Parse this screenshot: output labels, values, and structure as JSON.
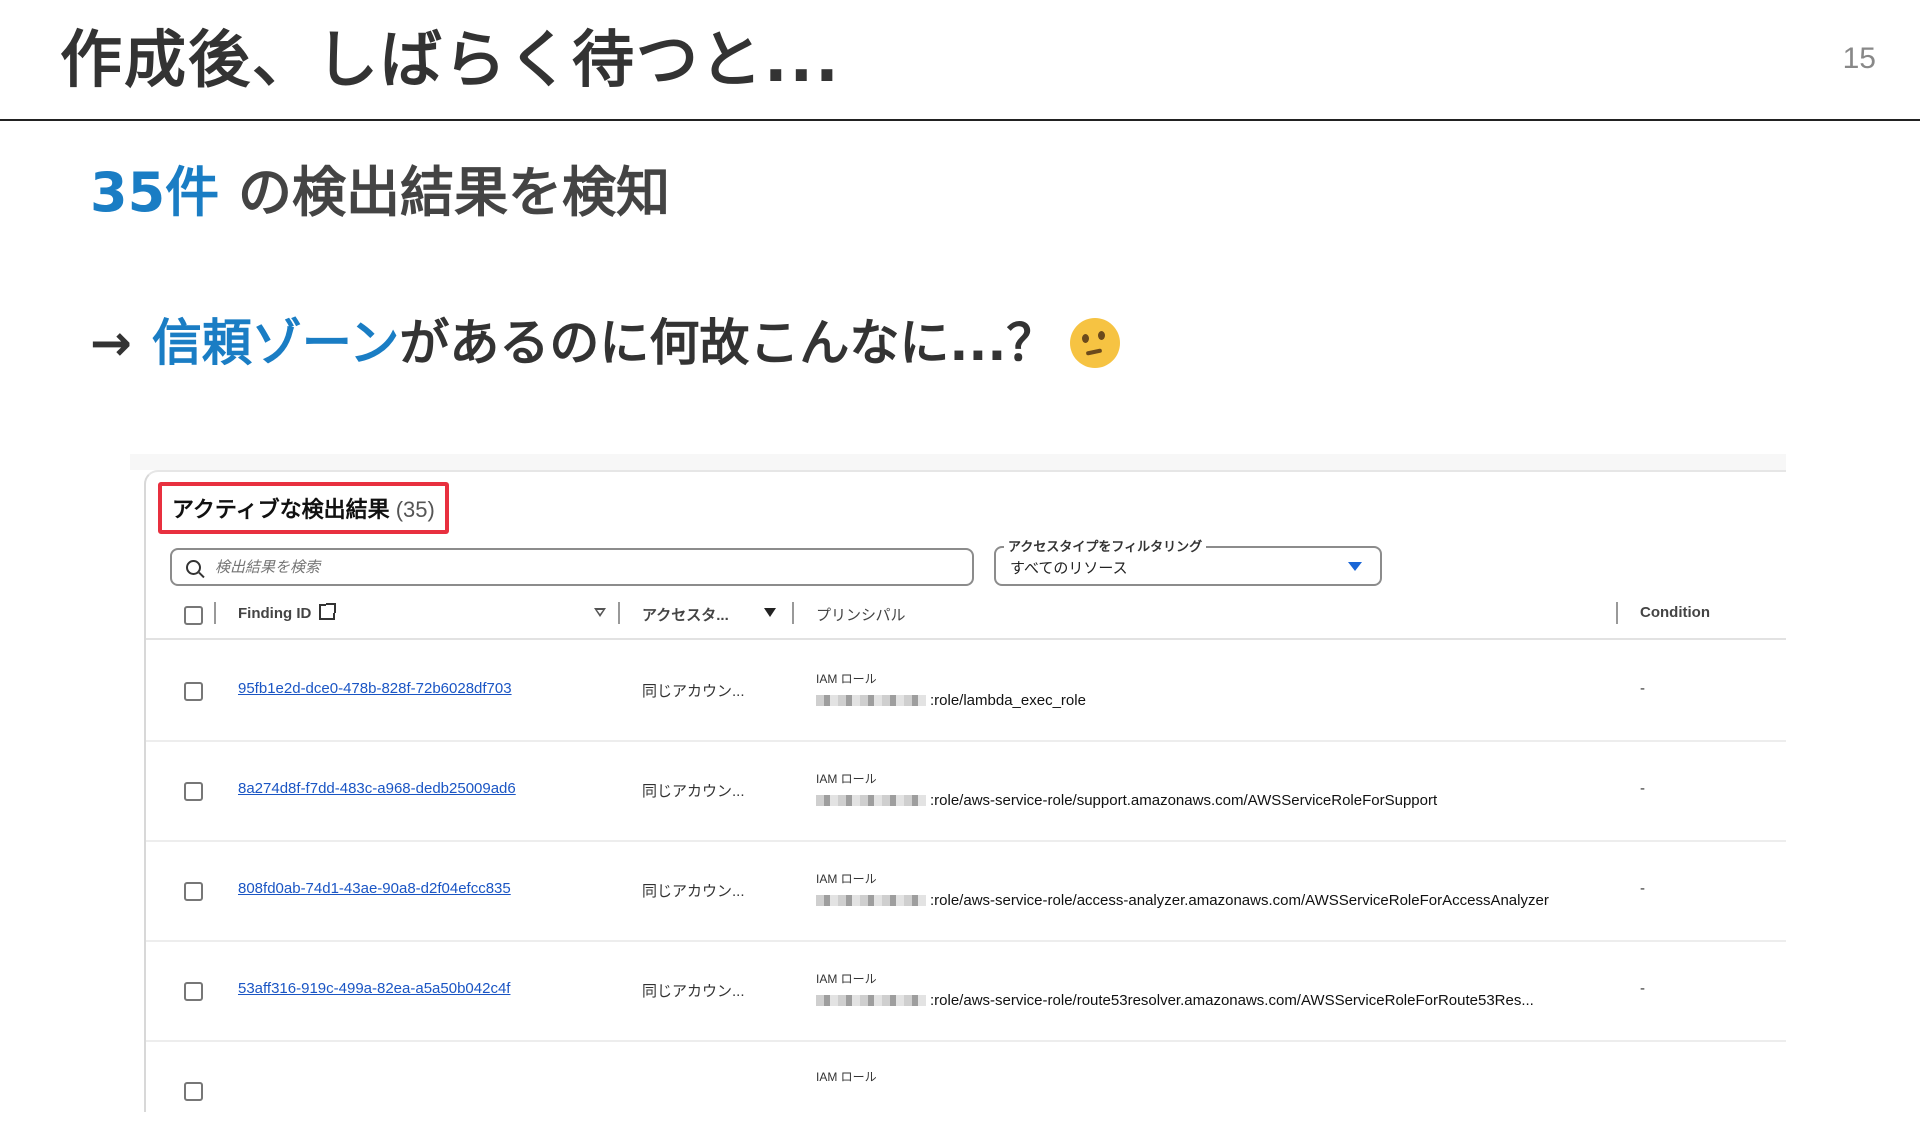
{
  "slide": {
    "title": "作成後、しばらく待つと...",
    "page_number": "15",
    "headline_accent": "35件",
    "headline_rest": " の検出結果を検知",
    "question_arrow": "→",
    "question_accent": "信頼ゾーン",
    "question_rest": " があるのに何故こんなに...？",
    "emoji": "thinking-face"
  },
  "panel": {
    "title": "アクティブな検出結果",
    "count": "(35)",
    "search_placeholder": "検出結果を検索",
    "filter_label": "アクセスタイプをフィルタリング",
    "filter_value": "すべてのリソース",
    "columns": {
      "finding_id": "Finding ID",
      "access": "アクセスタ...",
      "principal": "プリンシパル",
      "condition": "Condition"
    },
    "rows": [
      {
        "finding_id": "95fb1e2d-dce0-478b-828f-72b6028df703",
        "access": "同じアカウン...",
        "principal_type": "IAM ロール",
        "principal_arn": ":role/lambda_exec_role",
        "condition": "-"
      },
      {
        "finding_id": "8a274d8f-f7dd-483c-a968-dedb25009ad6",
        "access": "同じアカウン...",
        "principal_type": "IAM ロール",
        "principal_arn": ":role/aws-service-role/support.amazonaws.com/AWSServiceRoleForSupport",
        "condition": "-"
      },
      {
        "finding_id": "808fd0ab-74d1-43ae-90a8-d2f04efcc835",
        "access": "同じアカウン...",
        "principal_type": "IAM ロール",
        "principal_arn": ":role/aws-service-role/access-analyzer.amazonaws.com/AWSServiceRoleForAccessAnalyzer",
        "condition": "-"
      },
      {
        "finding_id": "53aff316-919c-499a-82ea-a5a50b042c4f",
        "access": "同じアカウン...",
        "principal_type": "IAM ロール",
        "principal_arn": ":role/aws-service-role/route53resolver.amazonaws.com/AWSServiceRoleForRoute53Res...",
        "condition": "-"
      },
      {
        "finding_id": "",
        "access": "",
        "principal_type": "IAM ロール",
        "principal_arn": "",
        "condition": ""
      }
    ]
  }
}
